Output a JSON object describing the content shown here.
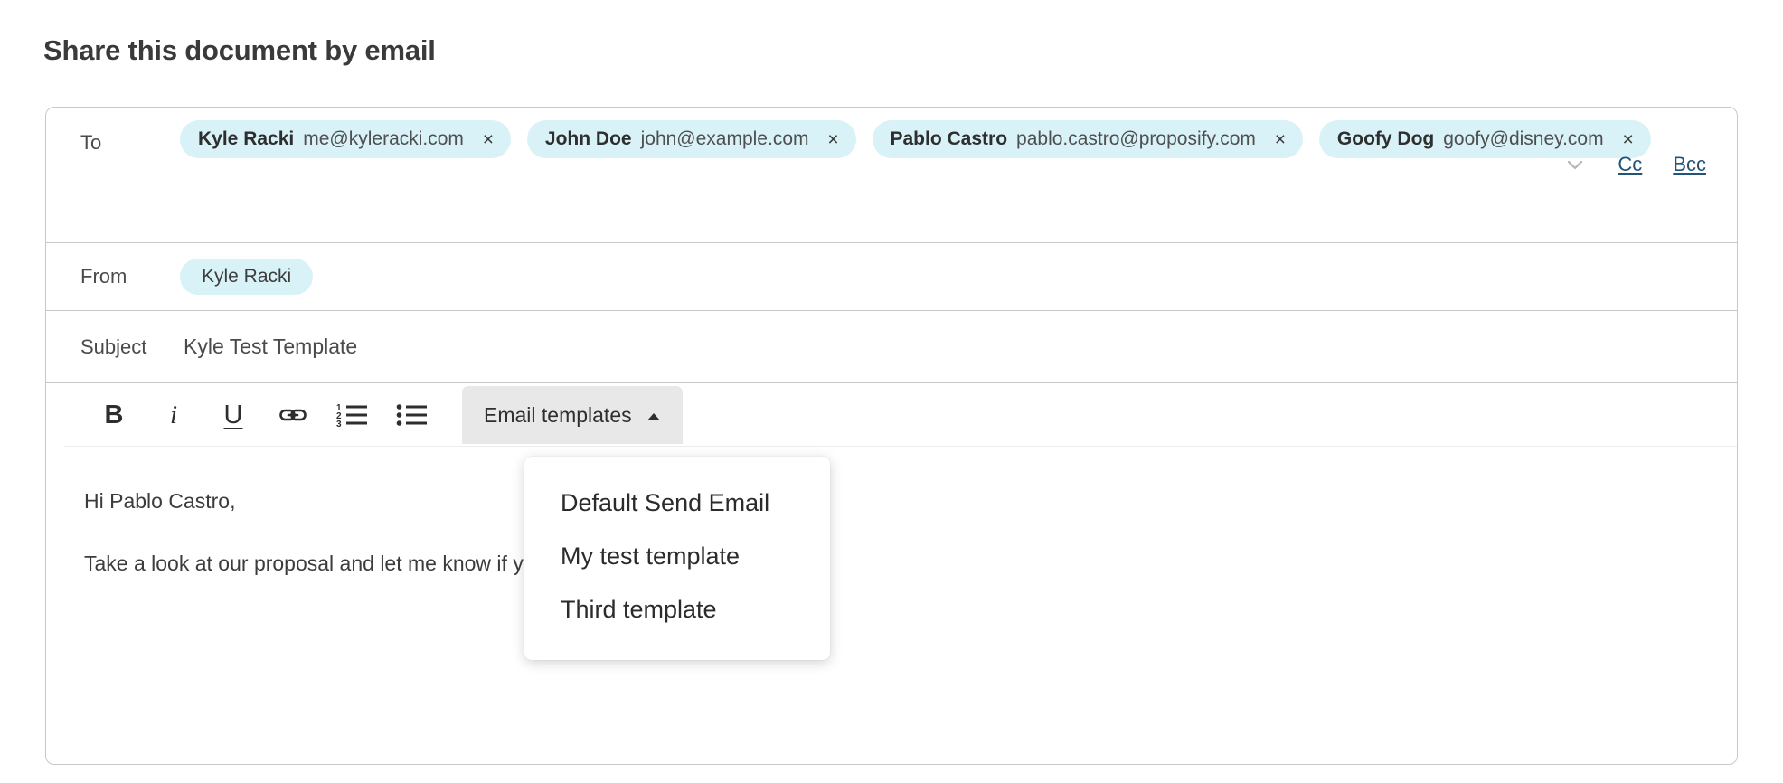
{
  "page_title": "Share this document by email",
  "colors": {
    "chip_bg": "#d8f2f8",
    "link": "#225379",
    "button_bg": "#e8e8e8",
    "card_border": "#c9c9c9"
  },
  "to_row": {
    "label": "To",
    "recipients": [
      {
        "name": "Kyle Racki",
        "email": "me@kyleracki.com",
        "remove": "×"
      },
      {
        "name": "John Doe",
        "email": "john@example.com",
        "remove": "×"
      },
      {
        "name": "Pablo Castro",
        "email": "pablo.castro@proposify.com",
        "remove": "×"
      },
      {
        "name": "Goofy Dog",
        "email": "goofy@disney.com",
        "remove": "×"
      }
    ],
    "expand_icon": "chevron-down-icon",
    "cc_label": "Cc",
    "bcc_label": "Bcc"
  },
  "from_row": {
    "label": "From",
    "sender": "Kyle Racki"
  },
  "subject_row": {
    "label": "Subject",
    "value": "Kyle Test Template",
    "placeholder": "Subject"
  },
  "toolbar": {
    "bold_label": "B",
    "italic_label": "i",
    "underline_label": "U",
    "link_icon": "link-icon",
    "ordered_list_icon": "ordered-list-icon",
    "bullet_list_icon": "bullet-list-icon",
    "templates_label": "Email templates",
    "templates_caret": "caret-up-icon"
  },
  "templates_menu": {
    "items": [
      {
        "label": "Default Send Email"
      },
      {
        "label": "My test template"
      },
      {
        "label": "Third template"
      }
    ]
  },
  "editor": {
    "greeting": "Hi Pablo Castro,",
    "paragraph": "Take a look at our proposal and let me know if you have any questions:"
  }
}
